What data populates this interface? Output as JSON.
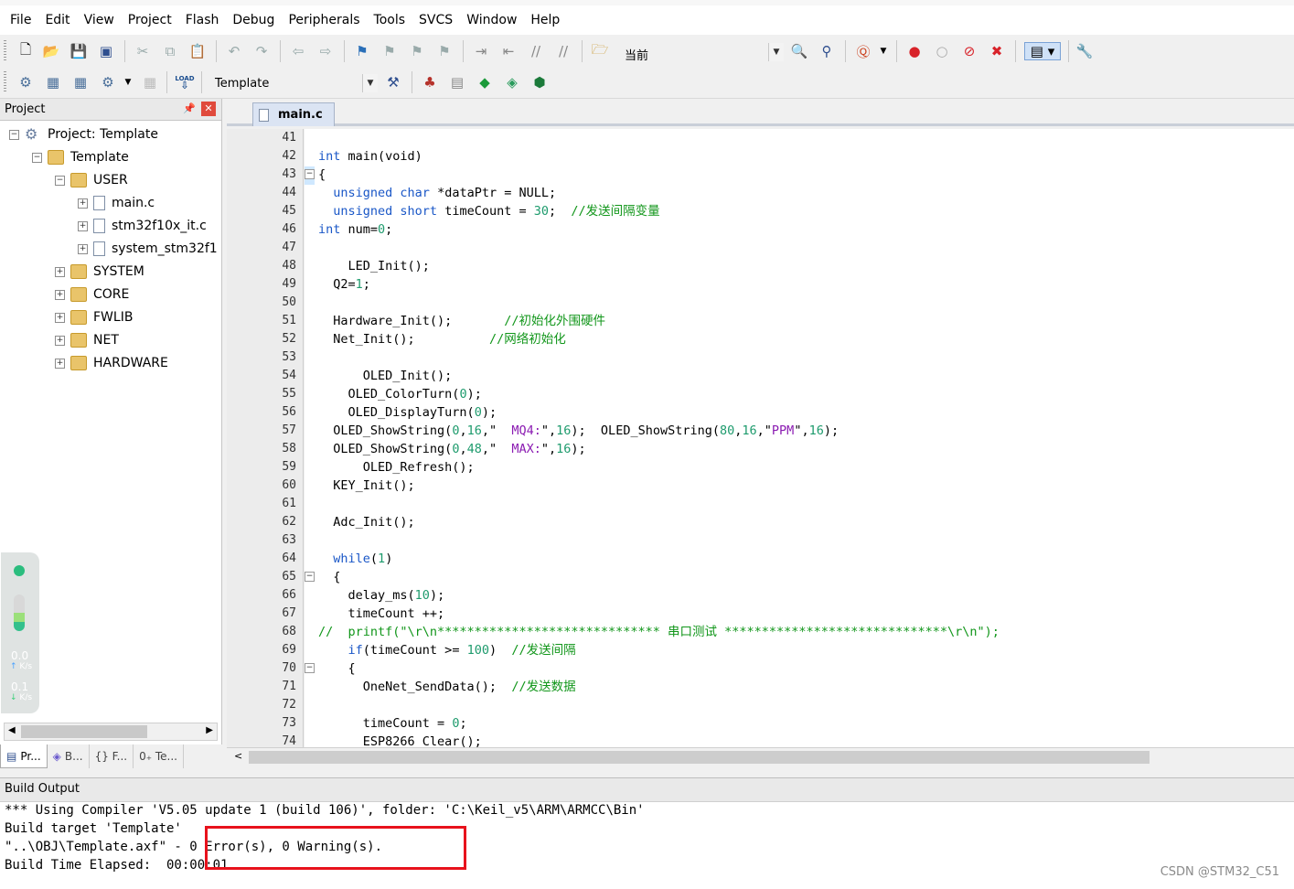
{
  "menubar": {
    "items": [
      "File",
      "Edit",
      "View",
      "Project",
      "Flash",
      "Debug",
      "Peripherals",
      "Tools",
      "SVCS",
      "Window",
      "Help"
    ]
  },
  "toolbar1": {
    "search_combo_value": "当前"
  },
  "toolbar2": {
    "target_combo_value": "Template",
    "load_label": "LOAD"
  },
  "project_panel": {
    "title": "Project",
    "tree": [
      {
        "label": "Project: Template",
        "kind": "project",
        "expanded": true
      },
      {
        "label": "Template",
        "kind": "target",
        "expanded": true
      },
      {
        "label": "USER",
        "kind": "folder",
        "expanded": true
      },
      {
        "label": "main.c",
        "kind": "file"
      },
      {
        "label": "stm32f10x_it.c",
        "kind": "file"
      },
      {
        "label": "system_stm32f1",
        "kind": "file"
      },
      {
        "label": "SYSTEM",
        "kind": "folder"
      },
      {
        "label": "CORE",
        "kind": "folder"
      },
      {
        "label": "FWLIB",
        "kind": "folder"
      },
      {
        "label": "NET",
        "kind": "folder"
      },
      {
        "label": "HARDWARE",
        "kind": "folder"
      }
    ],
    "tabs": [
      "Pr...",
      "B...",
      "{} F...",
      "0₊ Te..."
    ]
  },
  "net_widget": {
    "up_value": "0.0",
    "up_unit": "K/s",
    "down_value": "0.1",
    "down_unit": "K/s"
  },
  "editor": {
    "tab": "main.c",
    "lines": [
      {
        "n": "41",
        "segs": []
      },
      {
        "n": "42",
        "segs": [
          [
            "kw",
            "int"
          ],
          [
            "pu",
            " main"
          ],
          [
            "pu",
            "(void)"
          ]
        ]
      },
      {
        "n": "43",
        "segs": [
          [
            "pu",
            "{"
          ]
        ]
      },
      {
        "n": "44",
        "segs": [
          [
            "pu",
            "  "
          ],
          [
            "kw",
            "unsigned char"
          ],
          [
            "pu",
            " *dataPtr = NULL;"
          ]
        ]
      },
      {
        "n": "45",
        "segs": [
          [
            "pu",
            "  "
          ],
          [
            "kw",
            "unsigned short"
          ],
          [
            "pu",
            " timeCount = "
          ],
          [
            "nu",
            "30"
          ],
          [
            "pu",
            ";  "
          ],
          [
            "cm",
            "//发送间隔变量"
          ]
        ]
      },
      {
        "n": "46",
        "segs": [
          [
            "kw",
            "int"
          ],
          [
            "pu",
            " num="
          ],
          [
            "nu",
            "0"
          ],
          [
            "pu",
            ";"
          ]
        ]
      },
      {
        "n": "47",
        "segs": []
      },
      {
        "n": "48",
        "segs": [
          [
            "pu",
            "    LED_Init();"
          ]
        ]
      },
      {
        "n": "49",
        "segs": [
          [
            "pu",
            "  Q2="
          ],
          [
            "nu",
            "1"
          ],
          [
            "pu",
            ";"
          ]
        ]
      },
      {
        "n": "50",
        "segs": []
      },
      {
        "n": "51",
        "segs": [
          [
            "pu",
            "  Hardware_Init();       "
          ],
          [
            "cm",
            "//初始化外围硬件"
          ]
        ]
      },
      {
        "n": "52",
        "segs": [
          [
            "pu",
            "  Net_Init();          "
          ],
          [
            "cm",
            "//网络初始化"
          ]
        ]
      },
      {
        "n": "53",
        "segs": []
      },
      {
        "n": "54",
        "segs": [
          [
            "pu",
            "      OLED_Init();"
          ]
        ]
      },
      {
        "n": "55",
        "segs": [
          [
            "pu",
            "    OLED_ColorTurn("
          ],
          [
            "nu",
            "0"
          ],
          [
            "pu",
            ");"
          ]
        ]
      },
      {
        "n": "56",
        "segs": [
          [
            "pu",
            "    OLED_DisplayTurn("
          ],
          [
            "nu",
            "0"
          ],
          [
            "pu",
            ");"
          ]
        ]
      },
      {
        "n": "57",
        "segs": [
          [
            "pu",
            "  OLED_ShowString("
          ],
          [
            "nu",
            "0"
          ],
          [
            "pu",
            ","
          ],
          [
            "nu",
            "16"
          ],
          [
            "pu",
            ",\"  "
          ],
          [
            "st",
            "MQ4:"
          ],
          [
            "pu",
            "\","
          ],
          [
            "nu",
            "16"
          ],
          [
            "pu",
            ");  OLED_ShowString("
          ],
          [
            "nu",
            "80"
          ],
          [
            "pu",
            ","
          ],
          [
            "nu",
            "16"
          ],
          [
            "pu",
            ",\""
          ],
          [
            "st",
            "PPM"
          ],
          [
            "pu",
            "\","
          ],
          [
            "nu",
            "16"
          ],
          [
            "pu",
            ");"
          ]
        ]
      },
      {
        "n": "58",
        "segs": [
          [
            "pu",
            "  OLED_ShowString("
          ],
          [
            "nu",
            "0"
          ],
          [
            "pu",
            ","
          ],
          [
            "nu",
            "48"
          ],
          [
            "pu",
            ",\"  "
          ],
          [
            "st",
            "MAX:"
          ],
          [
            "pu",
            "\","
          ],
          [
            "nu",
            "16"
          ],
          [
            "pu",
            ");"
          ]
        ]
      },
      {
        "n": "59",
        "segs": [
          [
            "pu",
            "      OLED_Refresh();"
          ]
        ]
      },
      {
        "n": "60",
        "segs": [
          [
            "pu",
            "  KEY_Init();"
          ]
        ]
      },
      {
        "n": "61",
        "segs": []
      },
      {
        "n": "62",
        "segs": [
          [
            "pu",
            "  Adc_Init();"
          ]
        ]
      },
      {
        "n": "63",
        "segs": []
      },
      {
        "n": "64",
        "segs": [
          [
            "pu",
            "  "
          ],
          [
            "kw",
            "while"
          ],
          [
            "pu",
            "("
          ],
          [
            "nu",
            "1"
          ],
          [
            "pu",
            ")"
          ]
        ]
      },
      {
        "n": "65",
        "segs": [
          [
            "pu",
            "  {"
          ]
        ]
      },
      {
        "n": "66",
        "segs": [
          [
            "pu",
            "    delay_ms("
          ],
          [
            "nu",
            "10"
          ],
          [
            "pu",
            ");"
          ]
        ]
      },
      {
        "n": "67",
        "segs": [
          [
            "pu",
            "    timeCount ++;"
          ]
        ]
      },
      {
        "n": "68",
        "segs": [
          [
            "cm",
            "//  printf(\"\\r\\n****************************** 串口测试 ******************************\\r\\n\");"
          ]
        ]
      },
      {
        "n": "69",
        "segs": [
          [
            "pu",
            "    "
          ],
          [
            "kw",
            "if"
          ],
          [
            "pu",
            "(timeCount >= "
          ],
          [
            "nu",
            "100"
          ],
          [
            "pu",
            ")  "
          ],
          [
            "cm",
            "//发送间隔"
          ]
        ]
      },
      {
        "n": "70",
        "segs": [
          [
            "pu",
            "    {"
          ]
        ]
      },
      {
        "n": "71",
        "segs": [
          [
            "pu",
            "      OneNet_SendData();  "
          ],
          [
            "cm",
            "//发送数据"
          ]
        ]
      },
      {
        "n": "72",
        "segs": []
      },
      {
        "n": "73",
        "segs": [
          [
            "pu",
            "      timeCount = "
          ],
          [
            "nu",
            "0"
          ],
          [
            "pu",
            ";"
          ]
        ]
      },
      {
        "n": "74",
        "segs": [
          [
            "pu",
            "      ESP8266_Clear();"
          ]
        ]
      }
    ]
  },
  "build_output": {
    "title": "Build Output",
    "lines": [
      "*** Using Compiler 'V5.05 update 1 (build 106)', folder: 'C:\\Keil_v5\\ARM\\ARMCC\\Bin'",
      "Build target 'Template'",
      "\"..\\OBJ\\Template.axf\" - 0 Error(s), 0 Warning(s).",
      "Build Time Elapsed:  00:00:01"
    ]
  },
  "watermark": "CSDN @STM32_C51",
  "colors": {
    "keyword": "#1a57c7",
    "comment": "#11961a",
    "string": "#8b1cb2",
    "number": "#1e9b6d",
    "highlight_box": "#e8121c"
  }
}
